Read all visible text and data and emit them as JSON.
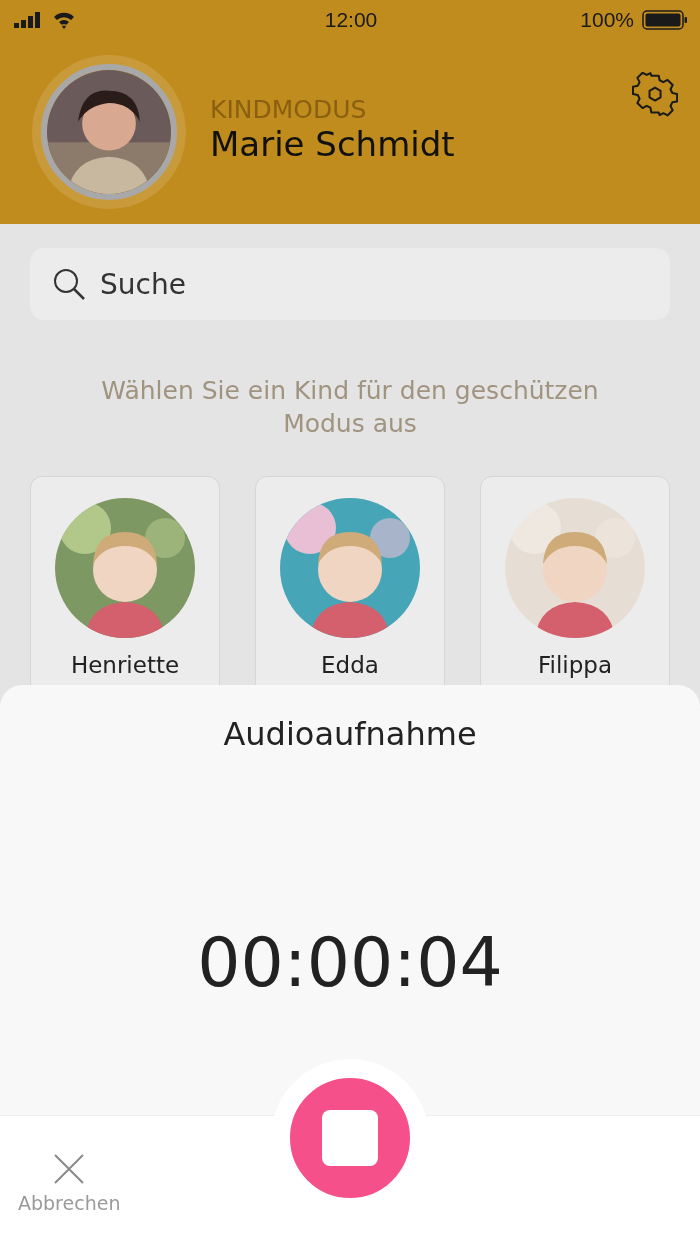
{
  "status_bar": {
    "time": "12:00",
    "battery": "100%"
  },
  "header": {
    "mode": "KINDMODUS",
    "name": "Marie Schmidt"
  },
  "search": {
    "placeholder": "Suche"
  },
  "prompt": "Wählen Sie ein Kind für den geschützen Modus aus",
  "children": [
    {
      "name": "Henriette",
      "kind": "picture"
    },
    {
      "name": "Edda",
      "kind": "picture"
    },
    {
      "name": "Filippa",
      "kind": "picture"
    }
  ],
  "sheet": {
    "title": "Audioaufnahme",
    "timer": "00:00:04"
  },
  "bottom_bar": {
    "cancel": "Abbrechen"
  }
}
